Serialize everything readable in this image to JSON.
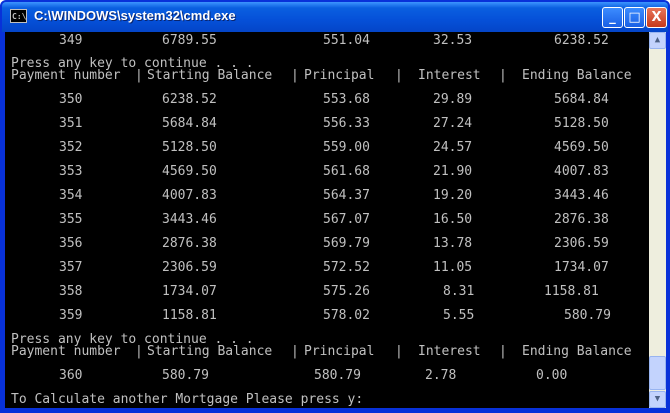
{
  "window": {
    "title": "C:\\WINDOWS\\system32\\cmd.exe",
    "icon_text": "C:\\",
    "controls": {
      "minimize": "_",
      "maximize": "□",
      "close": "X"
    }
  },
  "console": {
    "top_row": [
      "349",
      "6789.55",
      "551.04",
      "32.53",
      "6238.52"
    ],
    "prompt_continue": "Press any key to continue . . .",
    "header": [
      "Payment number",
      "|",
      "Starting Balance",
      "|",
      "Principal",
      "|",
      "Interest",
      "|",
      "Ending Balance"
    ],
    "block1": [
      [
        "350",
        "6238.52",
        "553.68",
        "29.89",
        "5684.84"
      ],
      [
        "351",
        "5684.84",
        "556.33",
        "27.24",
        "5128.50"
      ],
      [
        "352",
        "5128.50",
        "559.00",
        "24.57",
        "4569.50"
      ],
      [
        "353",
        "4569.50",
        "561.68",
        "21.90",
        "4007.83"
      ],
      [
        "354",
        "4007.83",
        "564.37",
        "19.20",
        "3443.46"
      ],
      [
        "355",
        "3443.46",
        "567.07",
        "16.50",
        "2876.38"
      ],
      [
        "356",
        "2876.38",
        "569.79",
        "13.78",
        "2306.59"
      ],
      [
        "357",
        "2306.59",
        "572.52",
        "11.05",
        "1734.07"
      ],
      [
        "358",
        "1734.07",
        "575.26",
        "8.31",
        "1158.81"
      ],
      [
        "359",
        "1158.81",
        "578.02",
        "5.55",
        "580.79"
      ]
    ],
    "prompt_continue_2": "Press any key to continue . . .",
    "header_2": [
      "Payment number",
      "|",
      "Starting Balance",
      "|",
      "Principal",
      "|",
      "Interest",
      "|",
      "Ending Balance"
    ],
    "block2": [
      [
        "360",
        "580.79",
        "580.79",
        "2.78",
        "0.00"
      ]
    ],
    "final_prompt": "To Calculate another Mortgage Please press y:"
  },
  "scrollbar": {
    "up_arrow": "▲",
    "down_arrow": "▼"
  },
  "colors": {
    "console_bg": "#000000",
    "console_text": "#c0c0c0",
    "titlebar": "#0550d8"
  }
}
